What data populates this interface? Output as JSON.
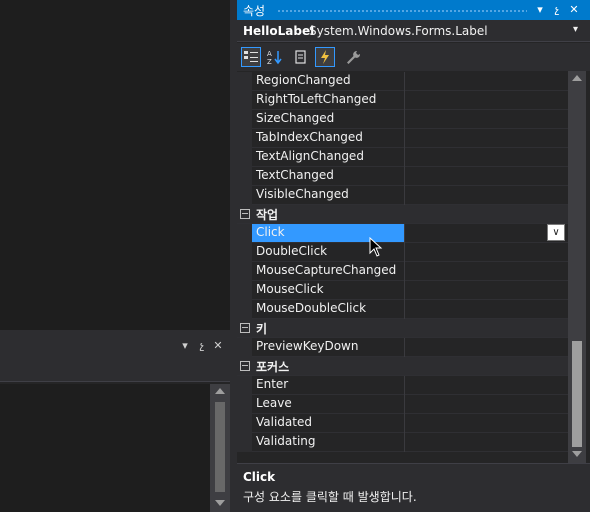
{
  "output_panel": {
    "pin_symbol": "չ",
    "close_symbol": "✕",
    "menu_symbol": "▾"
  },
  "properties": {
    "title": "속성",
    "object_name": "HelloLabel",
    "object_type": "System.Windows.Forms.Label",
    "title_buttons": {
      "menu": "▾",
      "pin": "չ",
      "close": "✕"
    },
    "toolbar": [
      {
        "name": "categorized-icon",
        "active": true
      },
      {
        "name": "alphabetical-icon",
        "active": false
      },
      {
        "name": "properties-icon",
        "active": false
      },
      {
        "name": "events-icon",
        "active": true
      },
      {
        "name": "property-pages-icon",
        "active": false
      }
    ],
    "rows": [
      {
        "type": "item",
        "label": "RegionChanged"
      },
      {
        "type": "item",
        "label": "RightToLeftChanged"
      },
      {
        "type": "item",
        "label": "SizeChanged"
      },
      {
        "type": "item",
        "label": "TabIndexChanged"
      },
      {
        "type": "item",
        "label": "TextAlignChanged"
      },
      {
        "type": "item",
        "label": "TextChanged"
      },
      {
        "type": "item",
        "label": "VisibleChanged"
      },
      {
        "type": "category",
        "label": "작업"
      },
      {
        "type": "item",
        "label": "Click",
        "selected": true
      },
      {
        "type": "item",
        "label": "DoubleClick"
      },
      {
        "type": "item",
        "label": "MouseCaptureChanged"
      },
      {
        "type": "item",
        "label": "MouseClick"
      },
      {
        "type": "item",
        "label": "MouseDoubleClick"
      },
      {
        "type": "category",
        "label": "키"
      },
      {
        "type": "item",
        "label": "PreviewKeyDown"
      },
      {
        "type": "category",
        "label": "포커스"
      },
      {
        "type": "item",
        "label": "Enter"
      },
      {
        "type": "item",
        "label": "Leave"
      },
      {
        "type": "item",
        "label": "Validated"
      },
      {
        "type": "item",
        "label": "Validating"
      }
    ],
    "description": {
      "title": "Click",
      "text": "구성 요소를 클릭할 때 발생합니다."
    }
  },
  "colors": {
    "accent": "#007acc",
    "selection": "#3399ff",
    "background": "#252526"
  }
}
